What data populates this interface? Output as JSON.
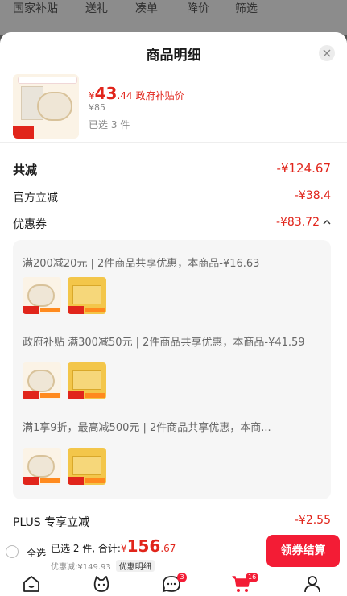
{
  "background": {
    "filters": [
      "国家补贴",
      "送礼",
      "凑单",
      "降价",
      "筛选"
    ]
  },
  "sheet": {
    "title": "商品明细",
    "product": {
      "price_yen": "¥",
      "price_int": "43",
      "price_dec": ".44",
      "subsidy_label": "政府补贴价",
      "original_price": "¥85",
      "selected_qty": "已选 3 件"
    },
    "rows": {
      "total_reduce": {
        "label": "共减",
        "value": "-¥124.67"
      },
      "official_reduce": {
        "label": "官方立减",
        "value": "-¥38.4"
      },
      "coupon": {
        "label": "优惠券",
        "value": "-¥83.72"
      },
      "plus_reduce": {
        "label": "PLUS 专享立减",
        "value": "-¥2.55"
      }
    },
    "coupons": [
      {
        "text": "满200减20元 | 2件商品共享优惠，本商品-¥16.63"
      },
      {
        "text": "政府补贴 满300减50元 | 2件商品共享优惠，本商品-¥41.59"
      },
      {
        "text": "满1享9折，最高减500元 | 2件商品共享优惠，本商..."
      }
    ]
  },
  "bottom_bar": {
    "select_all": "全选",
    "selected_summary": "已选 2 件, 合计:",
    "total_yen": "¥",
    "total_int": "156",
    "total_dec": ".67",
    "discount_text": "优惠减:¥149.93",
    "detail_label": "优惠明细",
    "checkout_label": "领券结算"
  },
  "tab_bar": {
    "messages_badge": "3",
    "cart_badge": "16"
  },
  "colors": {
    "accent_red": "#e1251b",
    "button_red": "#f31c35"
  }
}
